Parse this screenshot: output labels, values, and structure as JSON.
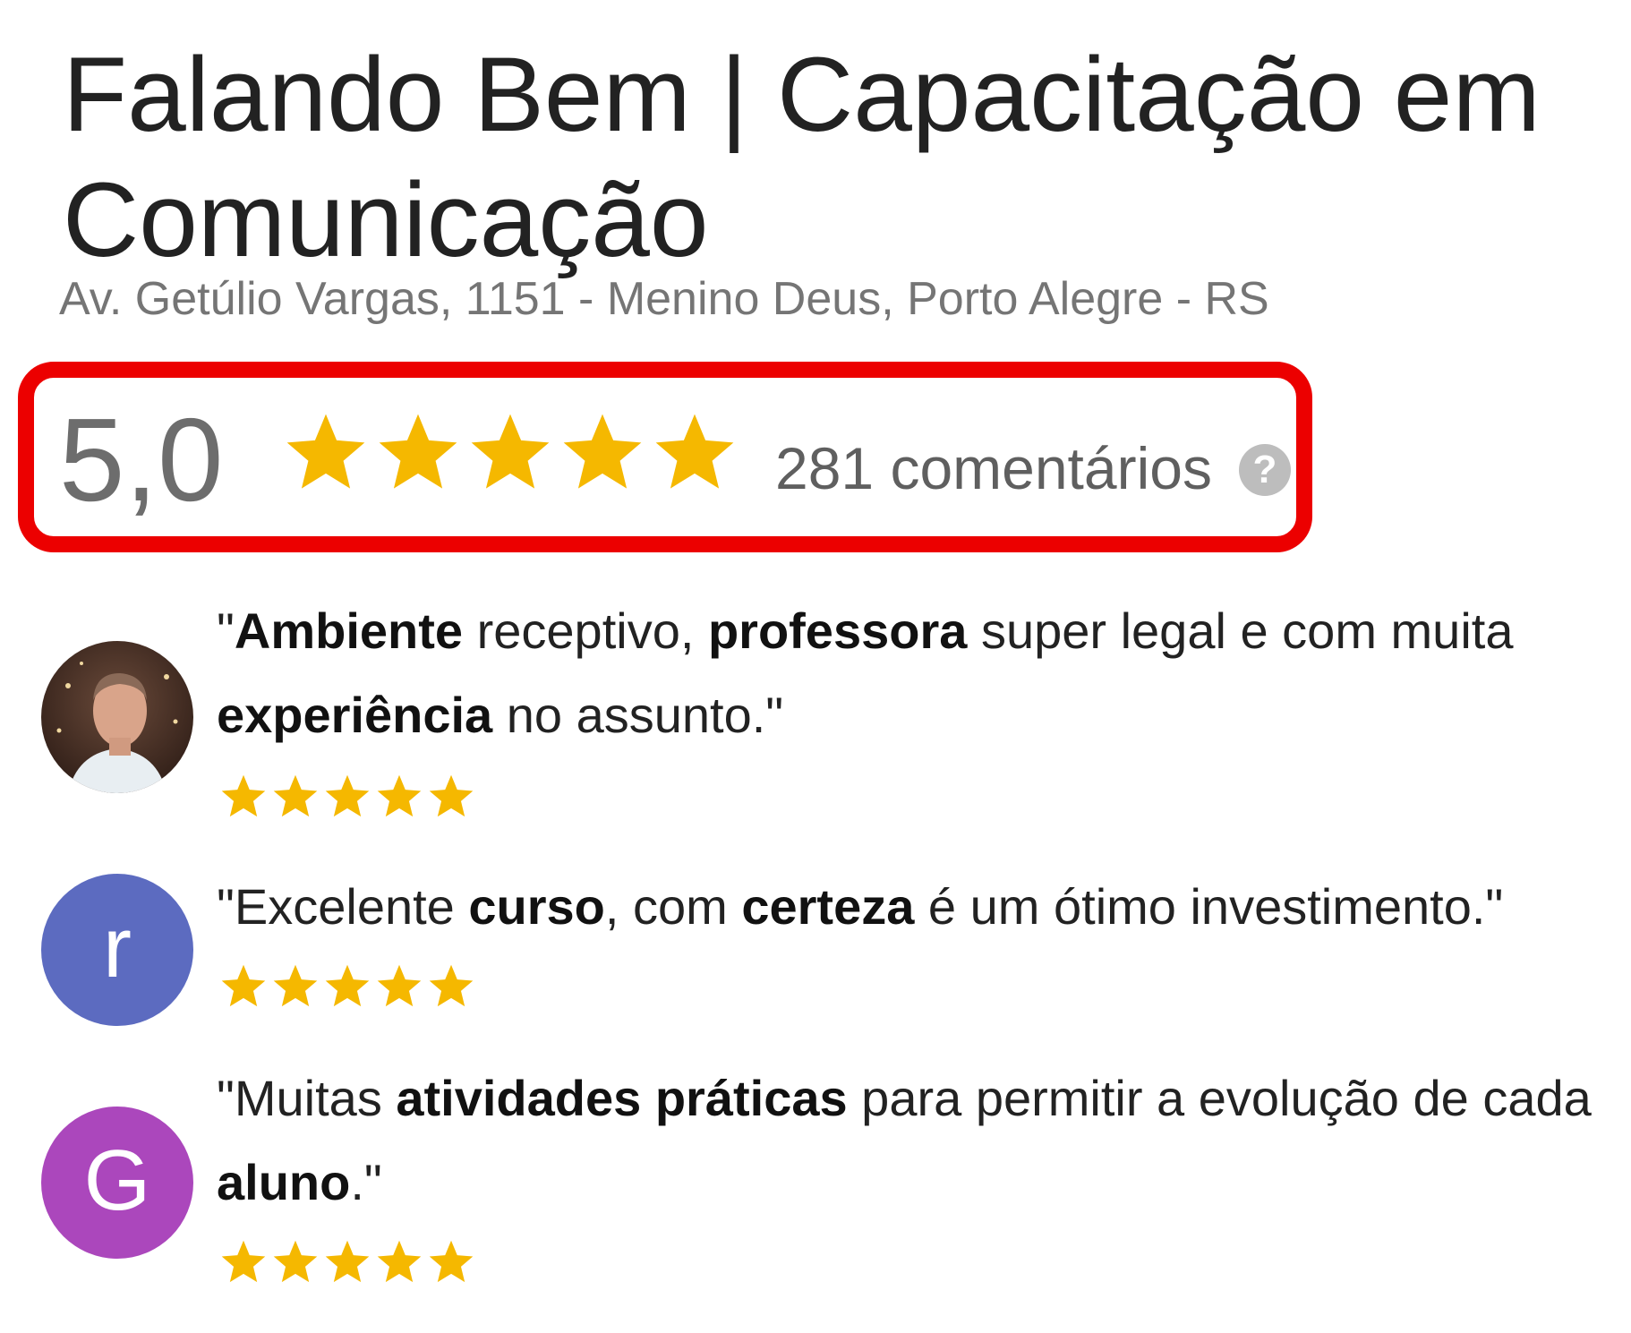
{
  "business": {
    "name": "Falando Bem | Capacitação em Comunicação",
    "address": "Av. Getúlio Vargas, 1151 - Menino Deus, Porto Alegre - RS"
  },
  "rating": {
    "value": "5,0",
    "stars": 5,
    "review_count": "281 comentários",
    "help_icon": "question-mark-icon",
    "help_glyph": "?"
  },
  "colors": {
    "star": "#f5b800",
    "highlight_border": "#ec0000",
    "avatar_r": "#5c6bc0",
    "avatar_g": "#ab47bc"
  },
  "reviews": [
    {
      "avatar_type": "photo",
      "segments": [
        {
          "text": "\"",
          "bold": false
        },
        {
          "text": "Ambiente",
          "bold": true
        },
        {
          "text": " receptivo, ",
          "bold": false
        },
        {
          "text": "professora",
          "bold": true
        },
        {
          "text": " super legal e com muita ",
          "bold": false
        },
        {
          "text": "experiência",
          "bold": true
        },
        {
          "text": " no assunto.\"",
          "bold": false
        }
      ],
      "stars": 5
    },
    {
      "avatar_type": "letter",
      "avatar_letter": "r",
      "segments": [
        {
          "text": "\"Excelente ",
          "bold": false
        },
        {
          "text": "curso",
          "bold": true
        },
        {
          "text": ", com ",
          "bold": false
        },
        {
          "text": "certeza",
          "bold": true
        },
        {
          "text": " é um ótimo investimento.\"",
          "bold": false
        }
      ],
      "stars": 5
    },
    {
      "avatar_type": "letter",
      "avatar_letter": "G",
      "segments": [
        {
          "text": "\"Muitas ",
          "bold": false
        },
        {
          "text": "atividades práticas",
          "bold": true
        },
        {
          "text": " para permitir a evolução de cada ",
          "bold": false
        },
        {
          "text": "aluno",
          "bold": true
        },
        {
          "text": ".\"",
          "bold": false
        }
      ],
      "stars": 5
    }
  ]
}
